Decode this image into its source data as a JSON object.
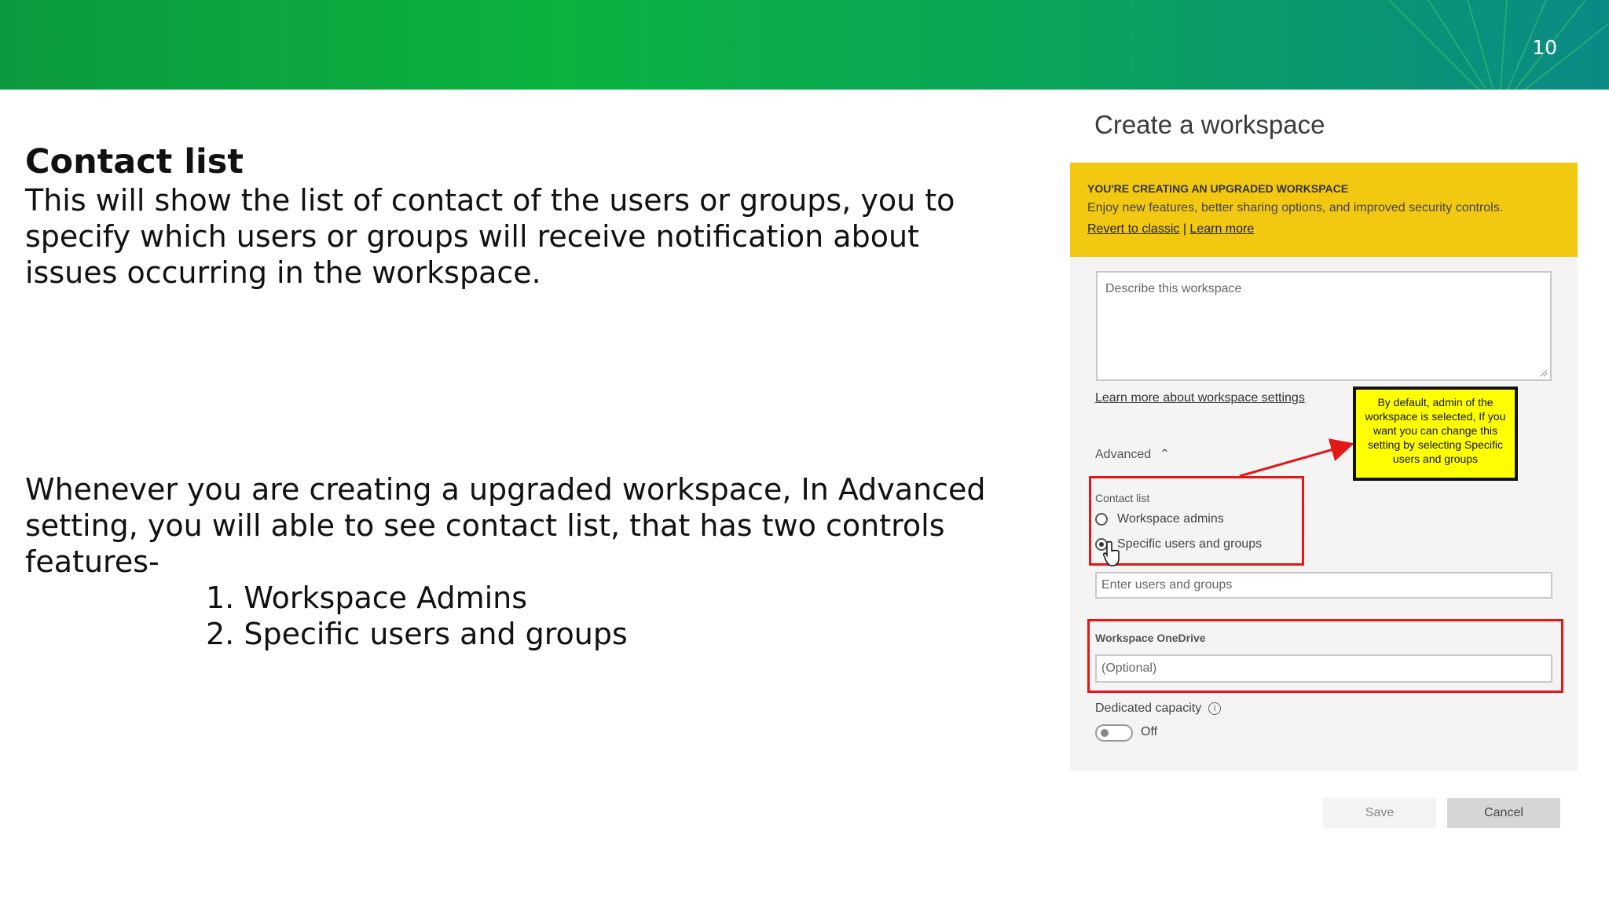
{
  "slide": {
    "page_number": "10",
    "heading": "Contact list",
    "intro_lines": [
      "This will show the list of contact of the users or groups, you to",
      "specify which users or groups will receive notification about",
      "issues occurring in the workspace."
    ],
    "body_lines": [
      "Whenever you are creating a upgraded workspace, In Advanced",
      "setting, you will able to see contact list, that has two controls",
      "features-"
    ],
    "list_items": [
      "1. Workspace Admins",
      "2. Specific users and groups"
    ]
  },
  "dialog": {
    "title": "Create a workspace",
    "banner": {
      "title": "YOU'RE CREATING AN UPGRADED WORKSPACE",
      "text": "Enjoy new features, better sharing options, and improved security controls.",
      "revert_link": "Revert to classic",
      "separator": " | ",
      "learn_link": "Learn more",
      "color": "#f2c811"
    },
    "description_placeholder": "Describe this workspace",
    "learn_settings_link": "Learn more about workspace settings",
    "advanced_label": "Advanced",
    "contact_list": {
      "label": "Contact list",
      "options": [
        {
          "label": "Workspace admins",
          "selected": false
        },
        {
          "label": "Specific users and groups",
          "selected": true
        }
      ],
      "users_placeholder": "Enter users and groups"
    },
    "onedrive": {
      "label": "Workspace OneDrive",
      "placeholder": "(Optional)"
    },
    "dedicated_capacity": {
      "label": "Dedicated capacity",
      "toggle_state": "Off"
    },
    "buttons": {
      "save": "Save",
      "cancel": "Cancel"
    }
  },
  "callout": {
    "text": "By default, admin of the workspace is selected, If you want you can change this setting by selecting Specific users and groups"
  },
  "colors": {
    "highlight": "#e01818",
    "callout_bg": "#ffff00",
    "banner_green": "#0bb340"
  }
}
